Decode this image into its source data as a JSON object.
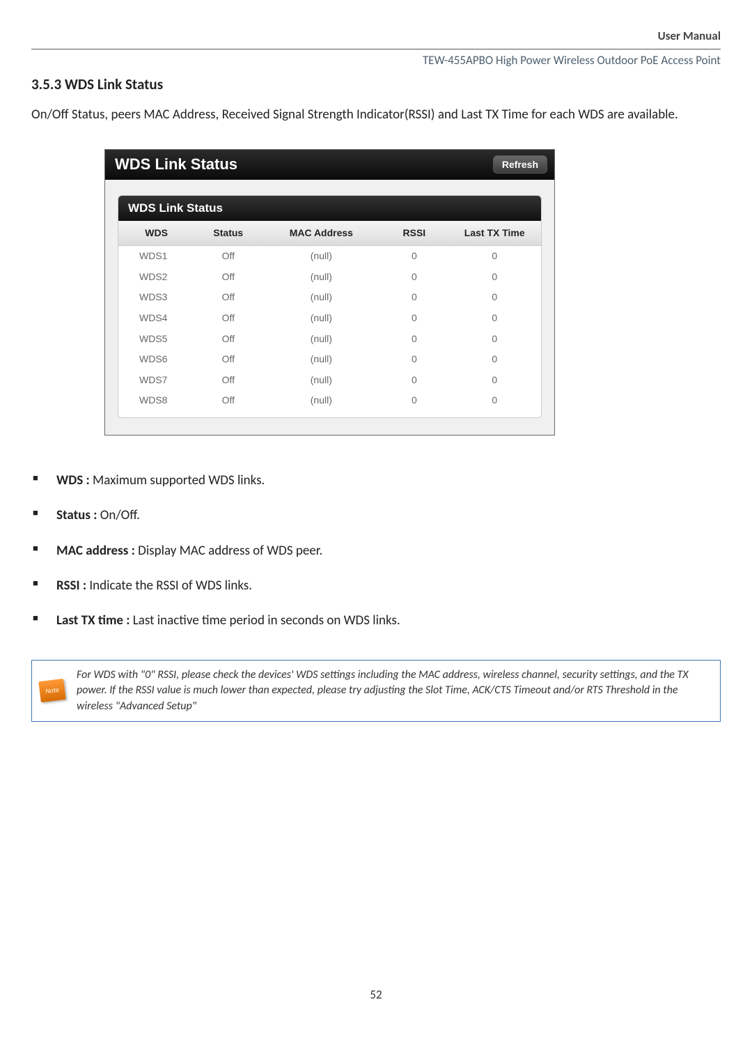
{
  "header": {
    "label": "User Manual",
    "subtitle": "TEW-455APBO High Power Wireless Outdoor PoE Access Point"
  },
  "section_title": "3.5.3 WDS Link Status",
  "intro": "On/Off Status, peers MAC Address, Received Signal Strength Indicator(RSSI) and Last TX Time for each WDS are available.",
  "panel": {
    "title": "WDS Link Status",
    "refresh": "Refresh",
    "sub_title": "WDS Link Status",
    "columns": {
      "c1": "WDS",
      "c2": "Status",
      "c3": "MAC Address",
      "c4": "RSSI",
      "c5": "Last TX Time"
    },
    "rows": [
      {
        "wds": "WDS1",
        "status": "Off",
        "mac": "(null)",
        "rssi": "0",
        "last": "0"
      },
      {
        "wds": "WDS2",
        "status": "Off",
        "mac": "(null)",
        "rssi": "0",
        "last": "0"
      },
      {
        "wds": "WDS3",
        "status": "Off",
        "mac": "(null)",
        "rssi": "0",
        "last": "0"
      },
      {
        "wds": "WDS4",
        "status": "Off",
        "mac": "(null)",
        "rssi": "0",
        "last": "0"
      },
      {
        "wds": "WDS5",
        "status": "Off",
        "mac": "(null)",
        "rssi": "0",
        "last": "0"
      },
      {
        "wds": "WDS6",
        "status": "Off",
        "mac": "(null)",
        "rssi": "0",
        "last": "0"
      },
      {
        "wds": "WDS7",
        "status": "Off",
        "mac": "(null)",
        "rssi": "0",
        "last": "0"
      },
      {
        "wds": "WDS8",
        "status": "Off",
        "mac": "(null)",
        "rssi": "0",
        "last": "0"
      }
    ]
  },
  "bullets": [
    {
      "term": "WDS :",
      "desc": " Maximum supported WDS links."
    },
    {
      "term": "Status :",
      "desc": " On/Off."
    },
    {
      "term": "MAC address :",
      "desc": " Display MAC address of WDS peer."
    },
    {
      "term": "RSSI :",
      "desc": " Indicate the RSSI of WDS links."
    },
    {
      "term": "Last TX time :",
      "desc": " Last inactive time period in seconds on WDS links."
    }
  ],
  "note": {
    "icon_label": "Note",
    "text": "For WDS with \"0\" RSSI, please check the devices' WDS settings including the MAC address, wireless channel, security settings, and the TX power. If the RSSI value is much lower than expected, please try adjusting the Slot Time, ACK/CTS Timeout and/or RTS Threshold in the wireless \"Advanced Setup\""
  },
  "page_number": "52"
}
